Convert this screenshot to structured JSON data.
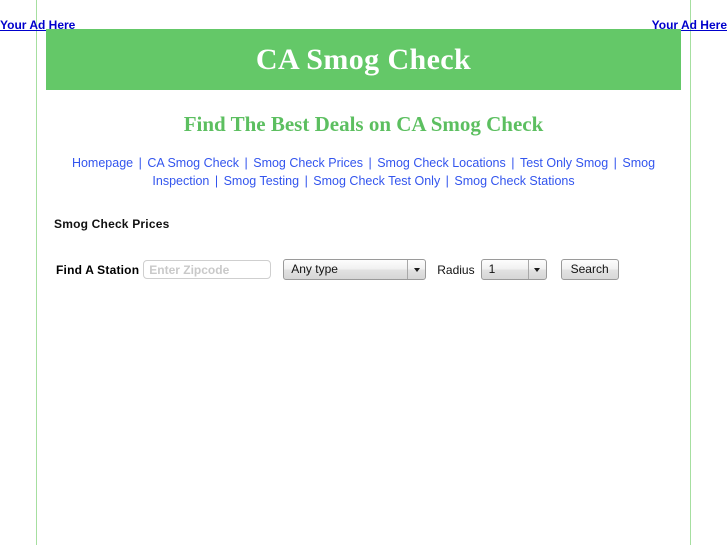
{
  "ads": {
    "left_label": "Your Ad Here",
    "right_label": "Your Ad Here"
  },
  "masthead": {
    "title": "CA Smog Check",
    "background_color": "#64c868",
    "text_color": "#ffffff"
  },
  "subheading": {
    "text": "Find The Best Deals on CA Smog Check",
    "color": "#5cbf60"
  },
  "nav": {
    "separator": "|",
    "link_color": "#3355ee",
    "items": [
      {
        "label": "Homepage"
      },
      {
        "label": "CA Smog Check"
      },
      {
        "label": "Smog Check Prices"
      },
      {
        "label": "Smog Check Locations"
      },
      {
        "label": "Test Only Smog"
      },
      {
        "label": "Smog Inspection"
      },
      {
        "label": "Smog Testing"
      },
      {
        "label": "Smog Check Test Only"
      },
      {
        "label": "Smog Check Stations"
      }
    ]
  },
  "section": {
    "title": "Smog Check Prices"
  },
  "search_form": {
    "label": "Find A Station",
    "zipcode": {
      "value": "",
      "placeholder": "Enter Zipcode"
    },
    "station_type": {
      "selected": "Any type",
      "options": [
        "Any type"
      ]
    },
    "radius_label": "Radius",
    "radius": {
      "selected": "1",
      "options": [
        "1"
      ]
    },
    "submit_label": "Search"
  },
  "frame": {
    "rule_color": "#a6dfa0"
  }
}
